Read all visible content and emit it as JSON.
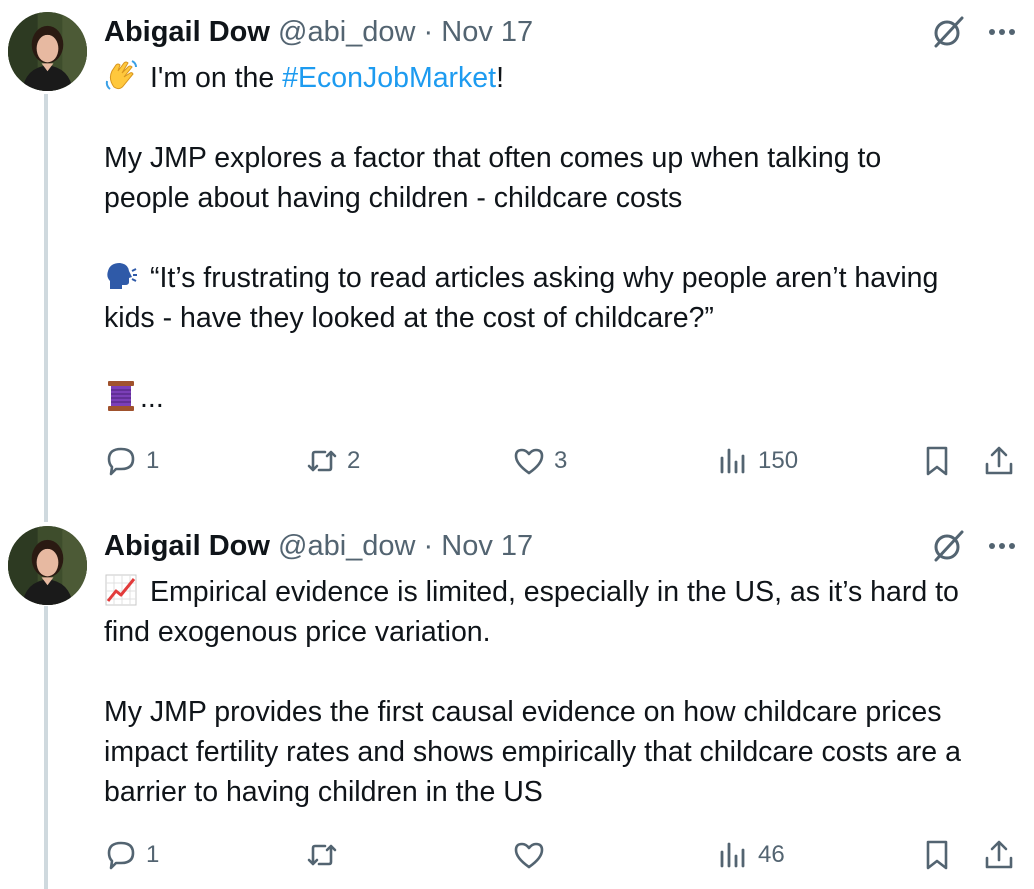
{
  "tweets": [
    {
      "name": "Abigail Dow",
      "handle": "@abi_dow",
      "separator": "·",
      "date": "Nov 17",
      "line1_emoji": "waving-hand-emoji",
      "line1_pre": "I'm on the ",
      "line1_hashtag": "#EconJobMarket",
      "line1_post": "!",
      "line2": "My JMP explores a factor that often comes up when talking to",
      "line3": "people about having children - childcare costs",
      "line4_emoji": "speaking-head-emoji",
      "line4": "“It’s frustrating to read articles asking why people aren’t having",
      "line5": "kids - have they looked at the cost of childcare?”",
      "line6_emoji": "thread-spool-emoji",
      "line6": "...",
      "replies": "1",
      "reposts": "2",
      "likes": "3",
      "views": "150"
    },
    {
      "name": "Abigail Dow",
      "handle": "@abi_dow",
      "separator": "·",
      "date": "Nov 17",
      "line1_emoji": "chart-increasing-emoji",
      "line1": "Empirical evidence is limited, especially in the US, as it’s hard to",
      "line2": "find exogenous price variation.",
      "line3": "My JMP provides the first causal evidence on how childcare prices",
      "line4": "impact fertility rates and shows empirically that childcare costs are a",
      "line5": "barrier to having children in the US",
      "replies": "1",
      "reposts": "",
      "likes": "",
      "views": "46"
    }
  ],
  "colors": {
    "text": "#0f1419",
    "secondary": "#536471",
    "link": "#1d9bf0",
    "thread_line": "#cfd9de"
  }
}
